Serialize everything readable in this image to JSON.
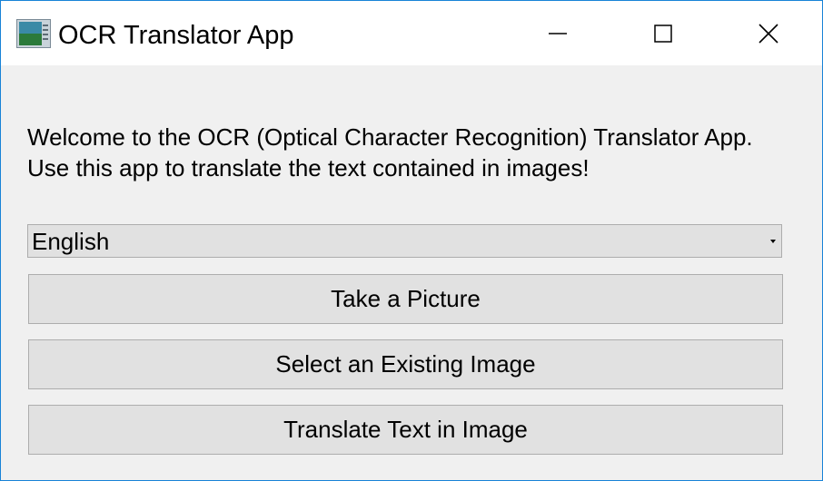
{
  "window": {
    "title": "OCR Translator App",
    "app_icon": "image-document-icon",
    "controls": {
      "minimize_icon": "minimize-icon",
      "maximize_icon": "maximize-icon",
      "close_icon": "close-icon"
    },
    "accent_color": "#1883d7"
  },
  "main": {
    "welcome_line_1": "Welcome to the OCR (Optical Character Recognition) Translator App.",
    "welcome_line_2": "Use this app to translate the text contained in images!",
    "language_select": {
      "selected": "English",
      "arrow_icon": "chevron-down-icon"
    },
    "buttons": {
      "take_picture": "Take a Picture",
      "select_existing": "Select an Existing Image",
      "translate": "Translate Text in Image"
    }
  }
}
